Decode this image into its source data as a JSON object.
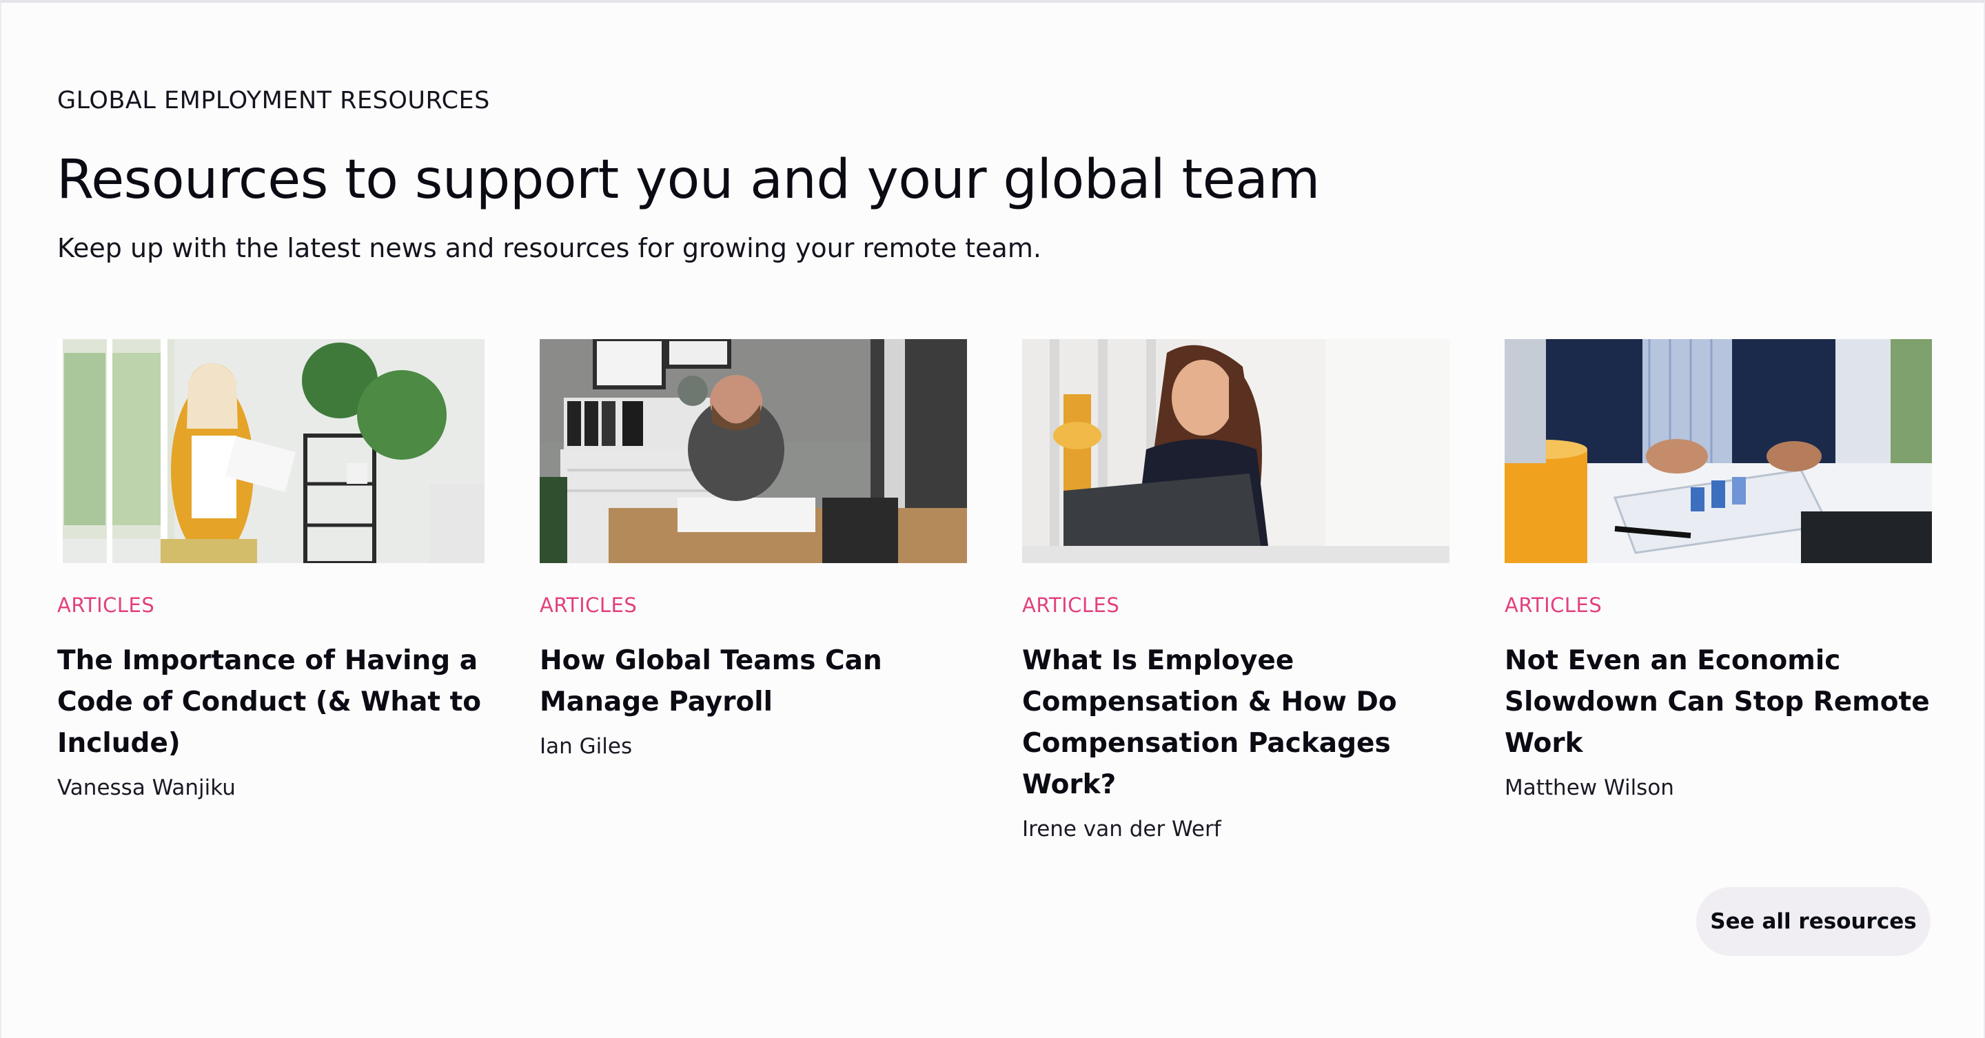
{
  "section": {
    "eyebrow": "GLOBAL EMPLOYMENT RESOURCES",
    "headline": "Resources to support you and your global team",
    "subhead": "Keep up with the latest news and resources for growing your remote team."
  },
  "cards": [
    {
      "category": "ARTICLES",
      "title": "The Importance of Having a Code of Conduct (& What to Include)",
      "author": "Vanessa Wanjiku"
    },
    {
      "category": "ARTICLES",
      "title": "How Global Teams Can Manage Payroll",
      "author": "Ian Giles"
    },
    {
      "category": "ARTICLES",
      "title": "What Is Employee Compensation & How Do Compensation Packages Work?",
      "author": "Irene van der Werf"
    },
    {
      "category": "ARTICLES",
      "title": "Not Even an Economic Slowdown Can Stop Remote Work",
      "author": "Matthew Wilson"
    }
  ],
  "cta": {
    "see_all_label": "See all resources"
  },
  "colors": {
    "accent_pink": "#e2407d",
    "button_bg": "#f0eef2",
    "text": "#0b0b14"
  }
}
